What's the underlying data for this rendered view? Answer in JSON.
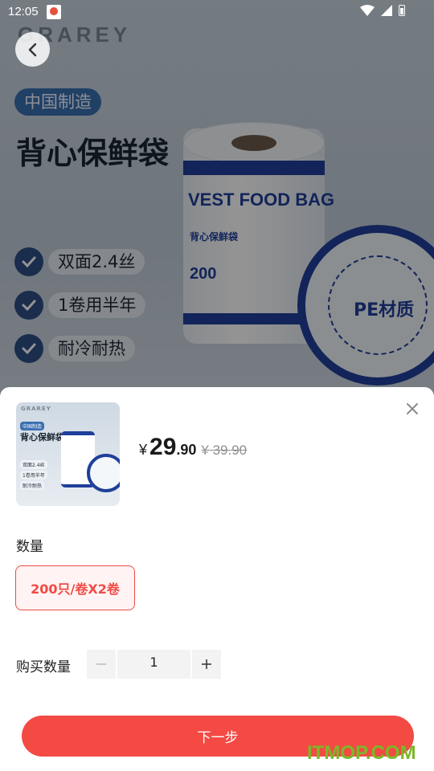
{
  "status_bar": {
    "time": "12:05"
  },
  "banner": {
    "brand": "GRAREY",
    "made_in": "中国制造",
    "title": "背心保鲜袋",
    "features": [
      "双面2.4丝",
      "1卷用半年",
      "耐冷耐热"
    ],
    "roll_text": "VEST FOOD BAG",
    "roll_sub": "背心保鲜袋",
    "roll_count": "200",
    "side_text": "PE材质"
  },
  "sheet": {
    "price": {
      "currency": "¥",
      "integer": "29",
      "decimal": ".90",
      "original": "¥ 39.90"
    },
    "quantity_label": "数量",
    "option_label": "200只/卷X2卷",
    "buy_qty_label": "购买数量",
    "buy_qty_value": "1",
    "next_button": "下一步"
  },
  "watermark": "ITMOP.COM",
  "colors": {
    "accent": "#f44a44",
    "brand_blue": "#1f3f9a"
  }
}
